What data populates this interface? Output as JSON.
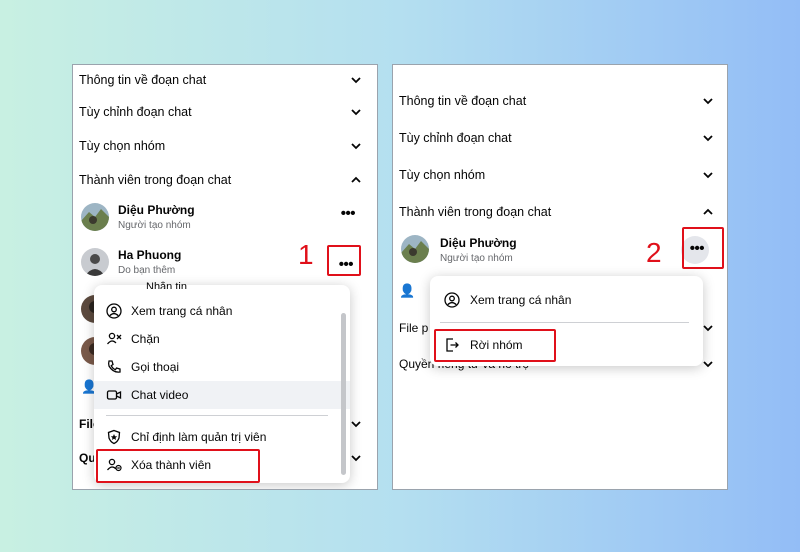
{
  "left_panel": {
    "sections": {
      "chat_info": "Thông tin về đoạn chat",
      "customize_chat": "Tùy chỉnh đoạn chat",
      "group_options": "Tùy chọn nhóm",
      "chat_members": "Thành viên trong đoạn chat"
    },
    "members": [
      {
        "name": "Diệu Phường",
        "role": "Người tạo nhóm"
      },
      {
        "name": "Ha Phuong",
        "role": "Do bạn thêm"
      }
    ],
    "partial_labels": {
      "top_cut": "Nhắn tin",
      "file": "File",
      "privacy": "Qu"
    },
    "step_number": "1",
    "member_menu": [
      {
        "label": "Xem trang cá nhân",
        "icon": "profile-icon"
      },
      {
        "label": "Chặn",
        "icon": "block-user-icon"
      },
      {
        "label": "Gọi thoại",
        "icon": "phone-icon"
      },
      {
        "label": "Chat video",
        "icon": "video-camera-icon"
      },
      {
        "label": "Chỉ định làm quản trị viên",
        "icon": "admin-shield-icon"
      },
      {
        "label": "Xóa thành viên",
        "icon": "remove-member-icon"
      }
    ]
  },
  "right_panel": {
    "sections": {
      "chat_info": "Thông tin về đoạn chat",
      "customize_chat": "Tùy chỉnh đoạn chat",
      "group_options": "Tùy chọn nhóm",
      "chat_members": "Thành viên trong đoạn chat"
    },
    "member": {
      "name": "Diệu Phường",
      "role": "Người tạo nhóm"
    },
    "partial_labels": {
      "file": "File p",
      "privacy": "Quyền riêng tư và hỗ trợ"
    },
    "step_number": "2",
    "member_menu": [
      {
        "label": "Xem trang cá nhân",
        "icon": "profile-icon"
      },
      {
        "label": "Rời nhóm",
        "icon": "leave-group-icon"
      }
    ]
  },
  "colors": {
    "highlight": "#e0101a",
    "secondary_text": "#65676b"
  }
}
